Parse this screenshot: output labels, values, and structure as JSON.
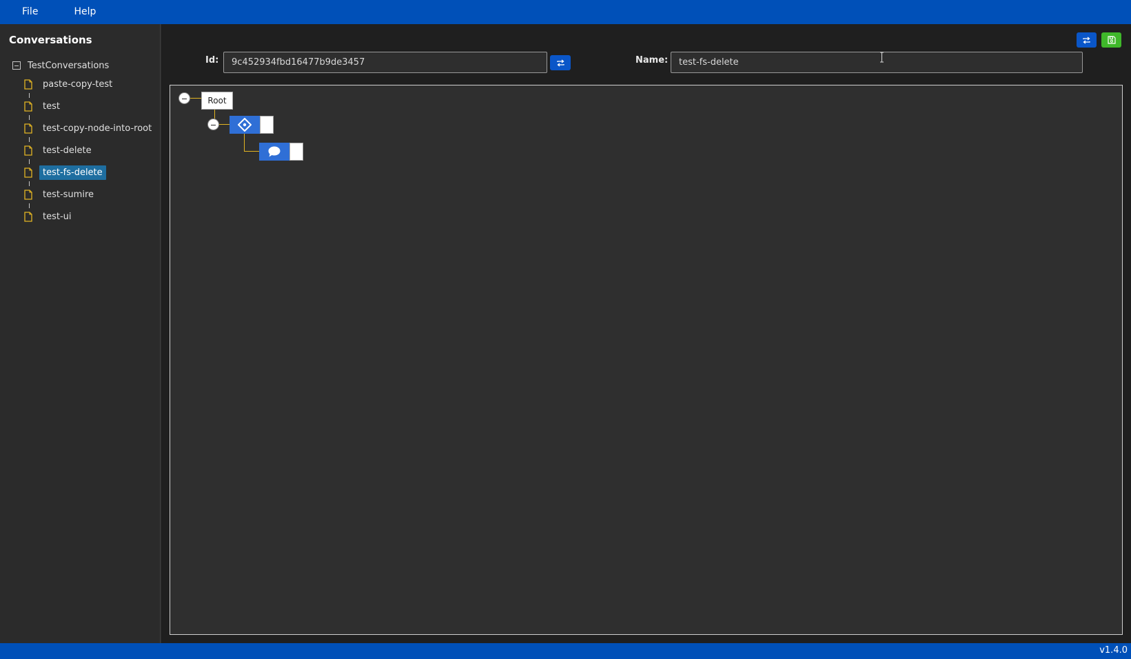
{
  "menu": {
    "file": "File",
    "help": "Help"
  },
  "sidebar": {
    "title": "Conversations",
    "root": "TestConversations",
    "items": [
      {
        "label": "paste-copy-test"
      },
      {
        "label": "test"
      },
      {
        "label": "test-copy-node-into-root"
      },
      {
        "label": "test-delete"
      },
      {
        "label": "test-fs-delete",
        "selected": true
      },
      {
        "label": "test-sumire"
      },
      {
        "label": "test-ui"
      }
    ]
  },
  "form": {
    "id_label": "Id:",
    "id_value": "9c452934fbd16477b9de3457",
    "name_label": "Name:",
    "name_value": "test-fs-delete"
  },
  "canvas": {
    "root_label": "Root",
    "nodes": [
      {
        "icon": "diamond-branch-icon"
      },
      {
        "icon": "speech-bubble-icon"
      }
    ]
  },
  "status": {
    "version": "v1.4.0"
  },
  "colors": {
    "accent": "#0050b8",
    "save": "#3fb82a",
    "node": "#2f6fd6",
    "link": "#e3b523",
    "selected": "#1e6ea0"
  }
}
